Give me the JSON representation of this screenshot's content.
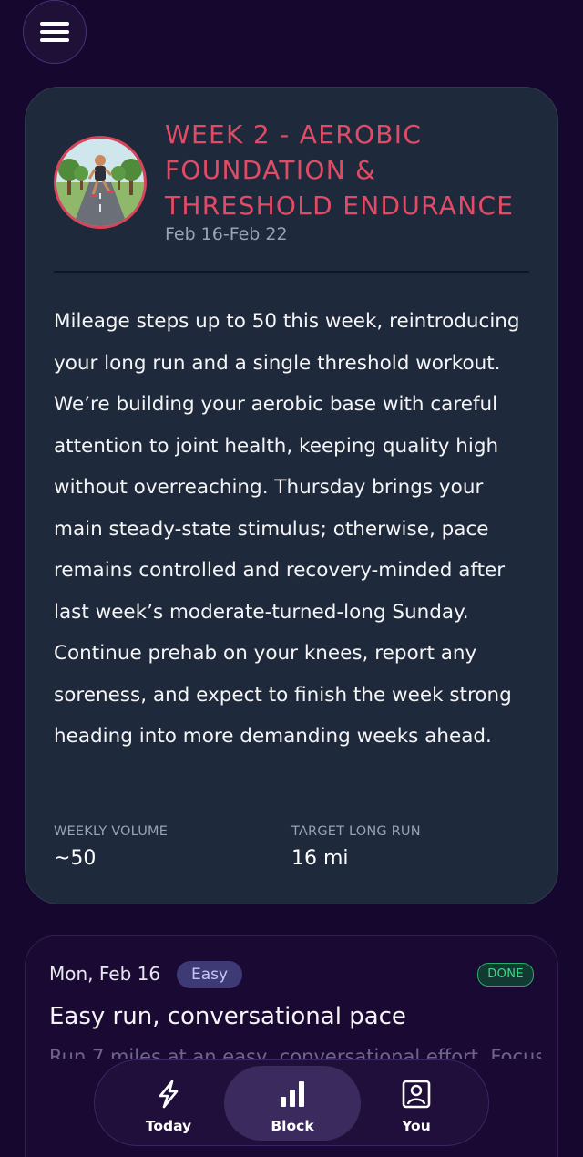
{
  "header": {
    "menu_icon": "hamburger-menu-icon"
  },
  "week": {
    "title": "WEEK 2 - AEROBIC FOUNDATION & THRESHOLD ENDURANCE",
    "dates": "Feb 16-Feb 22",
    "accent_color": "#e14b65",
    "summary": "Mileage steps up to 50 this week, reintroducing your long run and a single threshold workout. We’re building your aerobic base with careful attention to joint health, keeping quality high without overreaching. Thursday brings your main steady-state stimulus; otherwise, pace remains controlled and recovery-minded after last week’s moderate-turned-long Sunday. Continue prehab on your knees, report any soreness, and expect to finish the week strong heading into more demanding weeks ahead.",
    "stats": [
      {
        "label": "WEEKLY VOLUME",
        "value": "~50"
      },
      {
        "label": "TARGET LONG RUN",
        "value": "16 mi"
      }
    ]
  },
  "day": {
    "date": "Mon, Feb 16",
    "type": "Easy",
    "status": "DONE",
    "title": "Easy run, conversational pace",
    "description": "Run 7 miles at an easy, conversational effort. Focus"
  },
  "tabs": [
    {
      "label": "Today",
      "icon": "lightning-bolt-icon",
      "active": false
    },
    {
      "label": "Block",
      "icon": "bar-chart-icon",
      "active": true
    },
    {
      "label": "You",
      "icon": "user-profile-icon",
      "active": false
    }
  ]
}
